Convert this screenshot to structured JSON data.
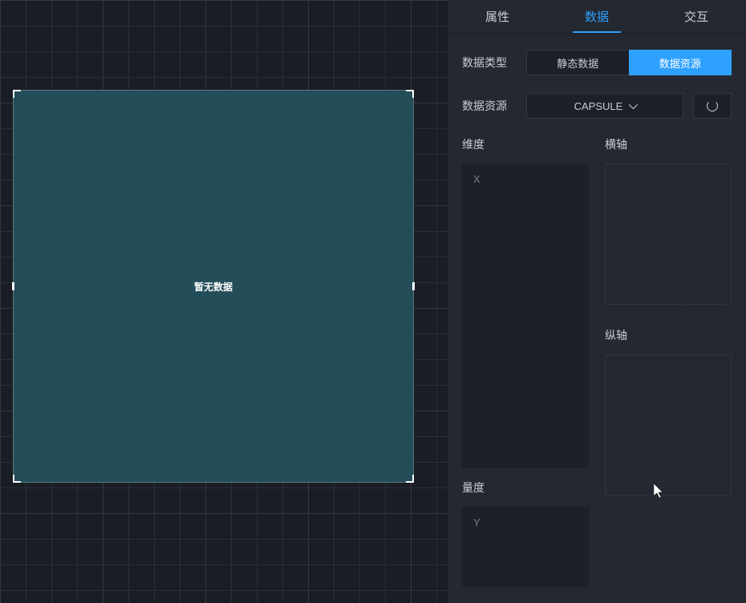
{
  "canvas": {
    "placeholder": "暂无数据"
  },
  "tabs": {
    "attributes": "属性",
    "data": "数据",
    "interaction": "交互"
  },
  "dataType": {
    "label": "数据类型",
    "static": "静态数据",
    "source": "数据资源"
  },
  "dataSource": {
    "label": "数据资源",
    "selected": "CAPSULE"
  },
  "columns": {
    "dimension": {
      "title": "维度",
      "field": "X"
    },
    "measure": {
      "title": "量度",
      "field": "Y"
    },
    "hAxis": {
      "title": "横轴"
    },
    "vAxis": {
      "title": "纵轴"
    }
  }
}
